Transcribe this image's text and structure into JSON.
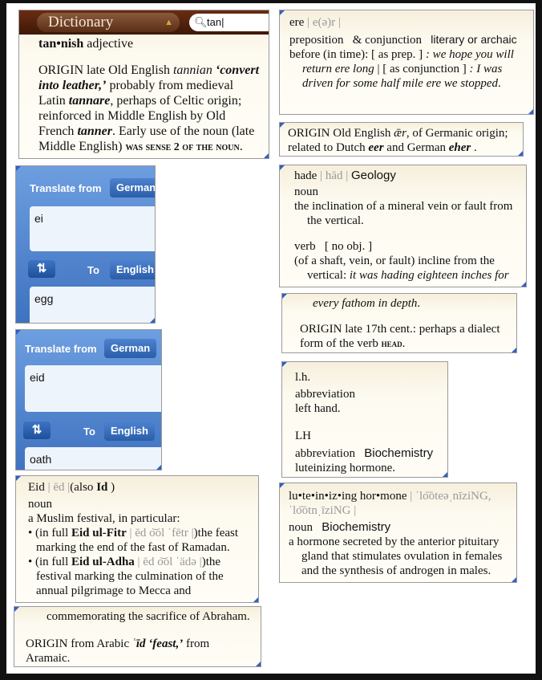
{
  "dictionary": {
    "selector": "Dictionary",
    "search_value": "tan",
    "icons": [
      "search-icon",
      "stepper-arrows-icon"
    ],
    "headword": "tan•nish",
    "pos": "adjective",
    "origin": [
      "ORIGIN late Old English ",
      "tannian",
      " ‘convert into leather,’",
      " probably from medieval Latin ",
      "tannare",
      ", perhaps of Celtic origin; reinforced in Middle English by Old French ",
      "tanner",
      ". Early use of the noun (late Middle English) ",
      "was sense 2 of the noun",
      "."
    ]
  },
  "ere": {
    "headword": "ere",
    "pron": "| e(ə)r |",
    "pos": "preposition",
    "pos2": "& conjunction",
    "register": "literary or archaic",
    "def": "before (in time): [ as prep. ] ",
    "ex1": ": we hope you will return ere long",
    "sep": " | [ as conjunction ] ",
    "ex2": ": I was driven for some half mile ere we stopped",
    "origin": [
      "ORIGIN Old English ",
      "ǣr",
      ", of Germanic origin; related to Dutch ",
      "eer",
      " and German ",
      "eher",
      " ."
    ]
  },
  "hade": {
    "headword": "hade",
    "pron": "| hād |",
    "field": "Geology",
    "pos": "noun",
    "def": "the inclination of a mineral vein or fault from the vertical.",
    "verb": "verb",
    "verb_note": "[ no obj. ]",
    "verb_def": "(of a shaft, vein, or fault) incline from the vertical: ",
    "verb_ex1": "it was hading eighteen inches for",
    "verb_ex2": "every fathom in depth",
    "origin": "ORIGIN late 17th cent.: perhaps a dialect form of the verb ",
    "origin_ref": "head"
  },
  "lh": {
    "hw1": "l.h.",
    "pos1": "abbreviation",
    "def1": "left hand.",
    "hw2": "LH",
    "pos2": "abbreviation",
    "field2": "Biochemistry",
    "def2": "luteinizing hormone."
  },
  "lut": {
    "headword": "lu•te•in•iz•ing hor•mone",
    "pron": "| ˈlo͞oteəˌnīziNG, ˈlo͞otnˌīziNG |",
    "pos": "noun",
    "field": "Biochemistry",
    "def": "a hormone secreted by the anterior pituitary gland that stimulates ovulation in females and the synthesis of androgen in males."
  },
  "translate": [
    {
      "from_label": "Translate from",
      "from_lang": "German",
      "input": "ei",
      "to_label": "To",
      "to_lang": "English",
      "output": "egg"
    },
    {
      "from_label": "Translate from",
      "from_lang": "German",
      "input": "eid",
      "to_label": "To",
      "to_lang": "English",
      "output": "oath"
    }
  ],
  "eid": {
    "headword": "Eid",
    "pron": "| ēd |",
    "also": "(also ",
    "also_word": "Id",
    " close": " )",
    "pos": "noun",
    "def": "a Muslim festival, in particular:",
    "s1_pre": "• (in full ",
    "s1_word": "Eid ul-Fitr",
    "s1_pron": " | ēd o͝ol ˈfētr |",
    "s1_def": ")the feast marking the end of the fast of Ramadan.",
    "s2_pre": "• (in full ",
    "s2_word": "Eid ul-Adha",
    "s2_pron": " | ēd o͝ol ˈädə |",
    "s2_def": ")the festival marking the culmination of the annual pilgrimage to Mecca and",
    "s2_cont": "commemorating the sacrifice of Abraham.",
    "origin": "ORIGIN from Arabic ",
    "origin_word": "ʿīd ‘feast,’",
    "origin_end": " from Aramaic."
  }
}
